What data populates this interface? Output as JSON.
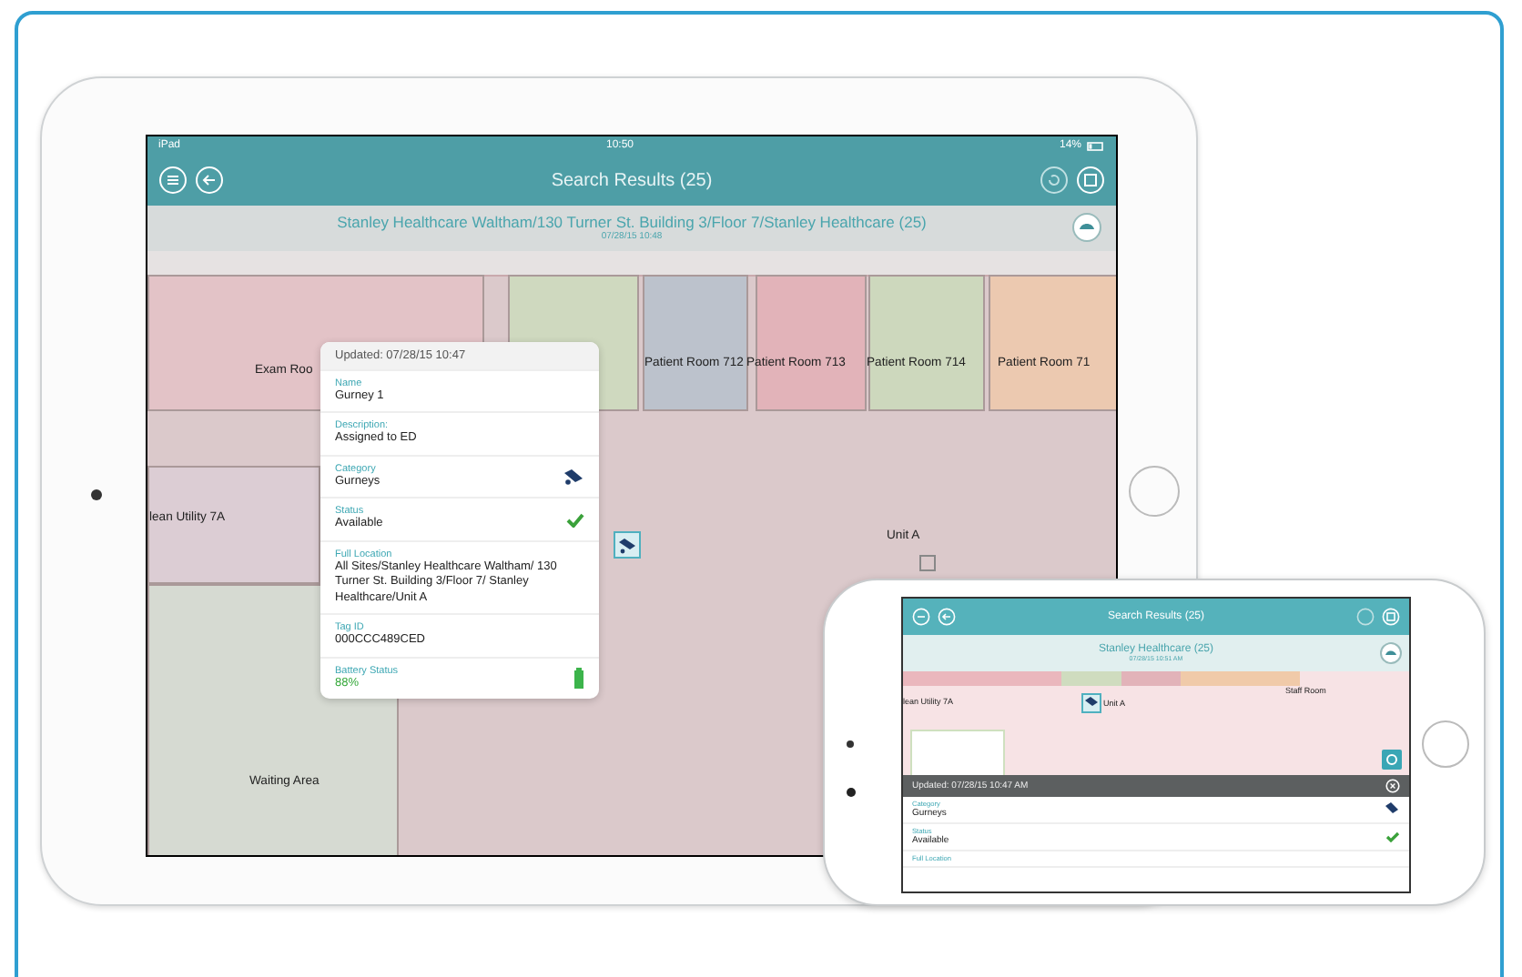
{
  "tablet": {
    "status_bar": {
      "carrier": "iPad",
      "time": "10:50",
      "battery": "14%"
    },
    "nav_title": "Search Results (25)",
    "breadcrumb": {
      "path": "Stanley Healthcare Waltham/130 Turner St. Building 3/Floor 7/Stanley Healthcare (25)",
      "timestamp": "07/28/15 10:48"
    },
    "map_labels": [
      {
        "label": "Exam Roo",
        "color": "#e3c3c7"
      },
      {
        "label": "Patient Room 712",
        "color": "#bcc2cc"
      },
      {
        "label": "Patient Room 713",
        "color": "#e2b3b9"
      },
      {
        "label": "Patient Room 714",
        "color": "#cdd8bd"
      },
      {
        "label": "Patient Room 71",
        "color": "#ecc9b0"
      },
      {
        "label": "lean Utility 7A",
        "color": "#dccdd4"
      },
      {
        "label": "Unit A"
      },
      {
        "label": "Waiting Area",
        "color": "#d6dad2"
      }
    ],
    "popover": {
      "updated": "Updated: 07/28/15 10:47",
      "fields": [
        {
          "kind": "text",
          "label": "Name",
          "value": "Gurney 1"
        },
        {
          "kind": "text",
          "label": "Description:",
          "value": "Assigned to ED"
        },
        {
          "kind": "category",
          "label": "Category",
          "value": "Gurneys"
        },
        {
          "kind": "status",
          "label": "Status",
          "value": "Available"
        },
        {
          "kind": "text",
          "label": "Full Location",
          "value": "All Sites/Stanley Healthcare Waltham/ 130 Turner St. Building 3/Floor 7/ Stanley Healthcare/Unit A"
        },
        {
          "kind": "text",
          "label": "Tag ID",
          "value": "000CCC489CED"
        },
        {
          "kind": "battery",
          "label": "Battery Status",
          "value": "88%"
        }
      ]
    }
  },
  "phone": {
    "nav_title": "Search Results (25)",
    "breadcrumb": {
      "path": "Stanley Healthcare (25)",
      "timestamp": "07/28/15 10:51 AM"
    },
    "map_labels": [
      {
        "label": "lean Utility 7A"
      },
      {
        "label": "Unit A"
      },
      {
        "label": "Staff Room"
      }
    ],
    "detail": {
      "updated": "Updated: 07/28/15 10:47 AM",
      "fields": [
        {
          "kind": "category",
          "label": "Category",
          "value": "Gurneys"
        },
        {
          "kind": "status",
          "label": "Status",
          "value": "Available"
        },
        {
          "kind": "label",
          "label": "Full Location"
        }
      ]
    }
  }
}
